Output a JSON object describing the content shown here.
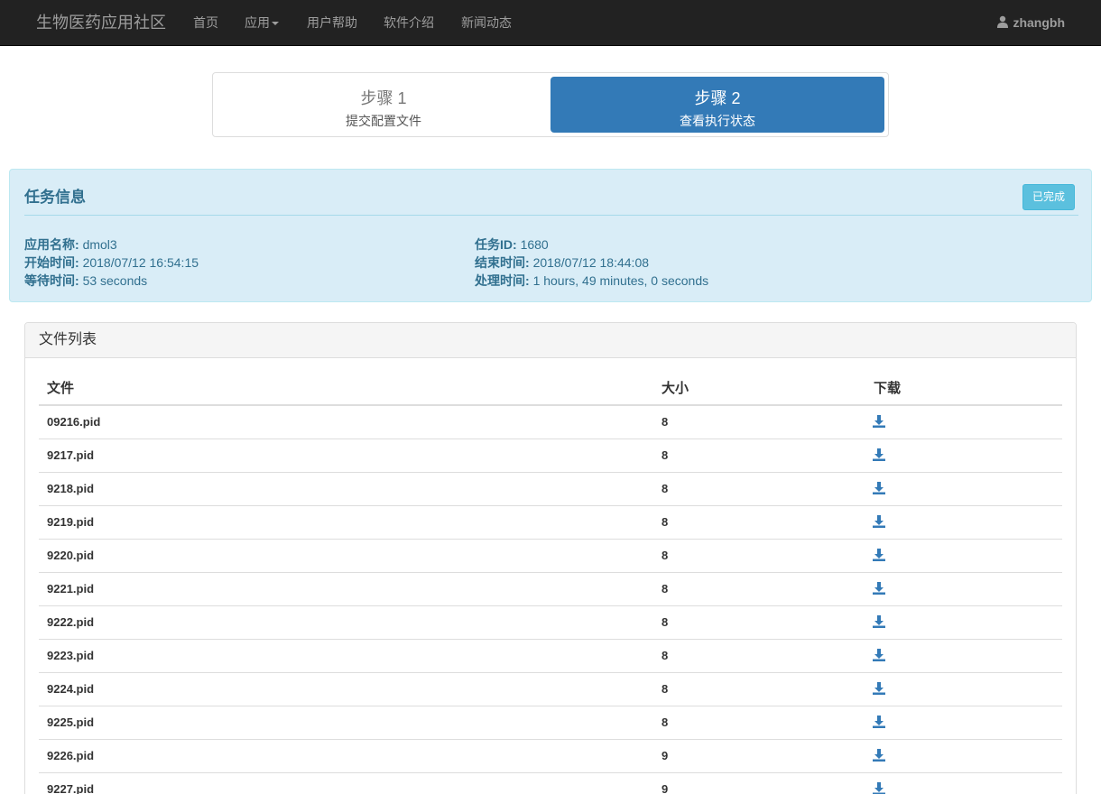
{
  "navbar": {
    "brand": "生物医药应用社区",
    "items": [
      "首页",
      "应用",
      "用户帮助",
      "软件介绍",
      "新闻动态"
    ],
    "user": "zhangbh"
  },
  "steps": [
    {
      "title": "步骤 1",
      "subtitle": "提交配置文件"
    },
    {
      "title": "步骤 2",
      "subtitle": "查看执行状态"
    }
  ],
  "task": {
    "title": "任务信息",
    "status": "已完成",
    "app_name_label": "应用名称:",
    "app_name": "dmol3",
    "start_label": "开始时间:",
    "start": "2018/07/12 16:54:15",
    "wait_label": "等待时间:",
    "wait": "53 seconds",
    "id_label": "任务ID:",
    "id": "1680",
    "end_label": "结束时间:",
    "end": "2018/07/12 18:44:08",
    "proc_label": "处理时间:",
    "proc": "1 hours, 49 minutes, 0 seconds"
  },
  "files": {
    "title": "文件列表",
    "columns": [
      "文件",
      "大小",
      "下载"
    ],
    "rows": [
      {
        "name": "09216.pid",
        "size": "8"
      },
      {
        "name": "9217.pid",
        "size": "8"
      },
      {
        "name": "9218.pid",
        "size": "8"
      },
      {
        "name": "9219.pid",
        "size": "8"
      },
      {
        "name": "9220.pid",
        "size": "8"
      },
      {
        "name": "9221.pid",
        "size": "8"
      },
      {
        "name": "9222.pid",
        "size": "8"
      },
      {
        "name": "9223.pid",
        "size": "8"
      },
      {
        "name": "9224.pid",
        "size": "8"
      },
      {
        "name": "9225.pid",
        "size": "8"
      },
      {
        "name": "9226.pid",
        "size": "9"
      },
      {
        "name": "9227.pid",
        "size": "9"
      }
    ]
  },
  "colors": {
    "navbar_bg": "#222222",
    "primary": "#337ab7",
    "info_bg": "#d9edf7",
    "info_text": "#31708f",
    "badge": "#5bc0de"
  }
}
